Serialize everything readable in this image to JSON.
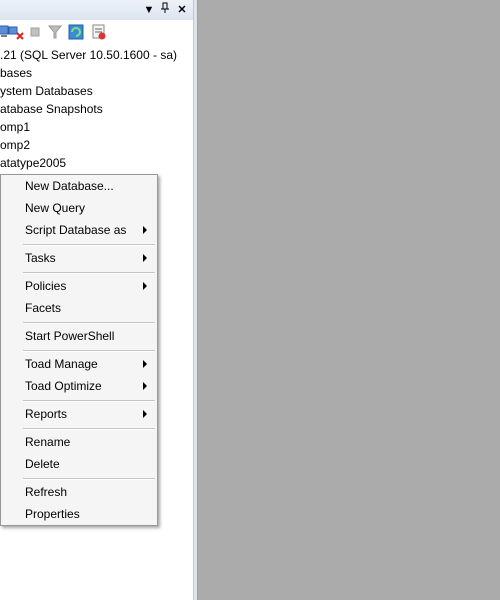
{
  "titlebar": {
    "dropdown_icon": "triangle-down",
    "pin_icon": "pin",
    "close_icon": "close"
  },
  "toolbar": {
    "icons": [
      "connect-icon",
      "disconnect-icon",
      "stop-icon",
      "filter-icon",
      "refresh-icon",
      "activity-monitor-icon"
    ]
  },
  "tree": {
    "server": ".21 (SQL Server 10.50.1600 - sa)",
    "items": [
      "bases",
      "ystem Databases",
      "atabase Snapshots",
      "omp1",
      "omp2",
      "atatype2005"
    ]
  },
  "context_menu": {
    "new_database": "New Database...",
    "new_query": "New Query",
    "script_database_as": "Script Database as",
    "tasks": "Tasks",
    "policies": "Policies",
    "facets": "Facets",
    "start_powershell": "Start PowerShell",
    "toad_manage": "Toad Manage",
    "toad_optimize": "Toad Optimize",
    "reports": "Reports",
    "rename": "Rename",
    "delete": "Delete",
    "refresh": "Refresh",
    "properties": "Properties"
  },
  "colors": {
    "menu_bg": "#f5f5f5",
    "doc_area": "#ababab",
    "titlebar": "#dde4ef"
  }
}
